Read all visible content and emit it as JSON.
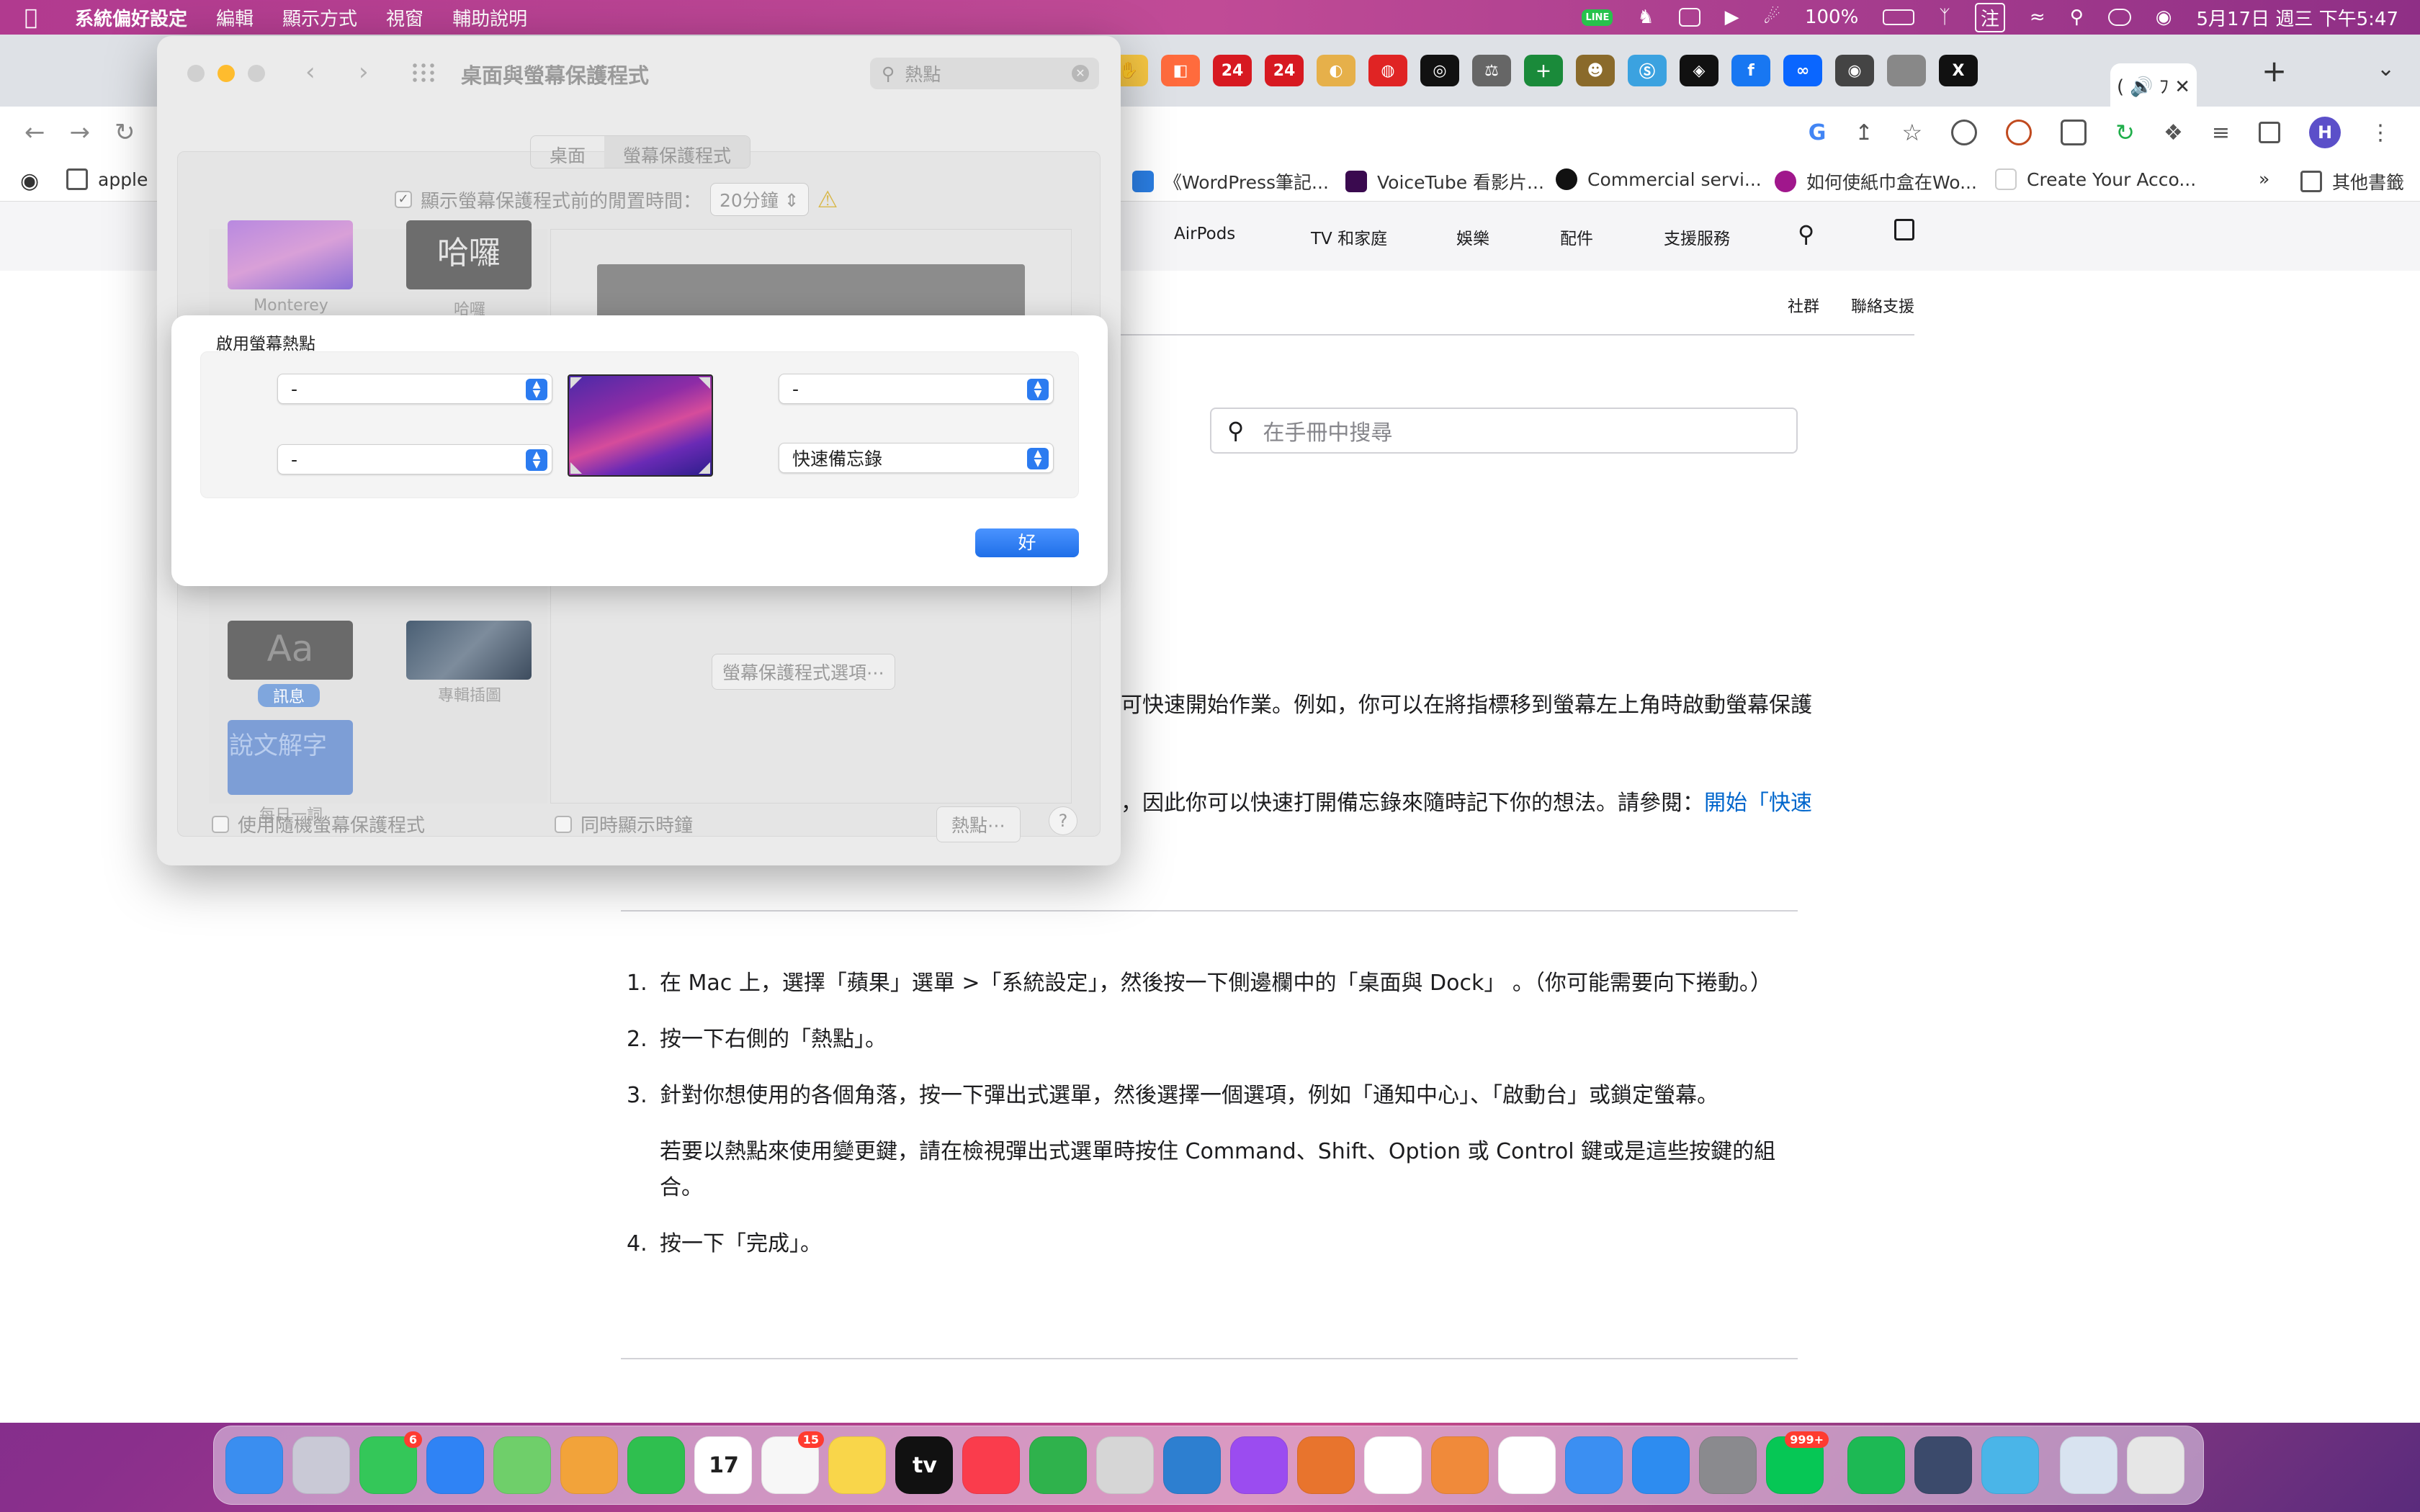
{
  "menubar": {
    "app_name": "系統偏好設定",
    "items": [
      "編輯",
      "顯示方式",
      "視窗",
      "輔助說明"
    ],
    "line_label": "LINE",
    "battery": "100%",
    "input_method": "注",
    "datetime": "5月17日 週三 下午5:47"
  },
  "browser": {
    "tab_favs": [
      {
        "label": "✋",
        "color": "#f5c542"
      },
      {
        "label": "◧",
        "color": "#ff6b3d"
      },
      {
        "label": "24",
        "color": "#d71921"
      },
      {
        "label": "24",
        "color": "#d71921"
      },
      {
        "label": "◐",
        "color": "#e6b04a"
      },
      {
        "label": "◍",
        "color": "#e02424"
      },
      {
        "label": "◎",
        "color": "#111111"
      },
      {
        "label": "⚖",
        "color": "#666666"
      },
      {
        "label": "＋",
        "color": "#1a8a3a"
      },
      {
        "label": "☻",
        "color": "#8a6a2b"
      },
      {
        "label": "Ⓢ",
        "color": "#3ba2e0"
      },
      {
        "label": "◈",
        "color": "#111111"
      },
      {
        "label": "f",
        "color": "#1877f2"
      },
      {
        "label": "∞",
        "color": "#0a66ff"
      },
      {
        "label": "◉",
        "color": "#444444"
      },
      {
        "label": "",
        "color": "#888888"
      },
      {
        "label": "X",
        "color": "#111111"
      }
    ],
    "active_tab_label": "( 🔊 ﾌ ✕",
    "bookmarks": [
      {
        "label": "apple"
      },
      {
        "label": "《WordPress筆記..."
      },
      {
        "label": "VoiceTube 看影片..."
      },
      {
        "label": "Commercial servi..."
      },
      {
        "label": "如何使紙巾盒在Wo..."
      },
      {
        "label": "Create Your Acco..."
      },
      {
        "label": "其他書籤"
      }
    ],
    "bookmark_more": "»",
    "profile_initial": "H"
  },
  "apple_page": {
    "nav": [
      "AirPods",
      "TV 和家庭",
      "娛樂",
      "配件",
      "支援服務"
    ],
    "subnav": [
      "社群",
      "聯絡支援"
    ],
    "search_placeholder": "在手冊中搜尋",
    "para1": "可快速開始作業。例如，你可以在將指標移到螢幕左上角時啟動螢幕保護",
    "para2_text": "，因此你可以快速打開備忘錄來隨時記下你的想法。請參閱：",
    "para2_link": "開始「快速",
    "steps": [
      {
        "n": "1.",
        "text": "在 Mac 上，選擇「蘋果」選單  >「系統設定」，然後按一下側邊欄中的「桌面與 Dock」 。（你可能需要向下捲動。）"
      },
      {
        "n": "2.",
        "text": "按一下右側的「熱點」。"
      },
      {
        "n": "3.",
        "text": "針對你想使用的各個角落，按一下彈出式選單，然後選擇一個選項，例如「通知中心」、「啟動台」或鎖定螢幕。"
      }
    ],
    "step3_note_line1": "若要以熱點來使用變更鍵，請在檢視彈出式選單時按住 Command、Shift、Option 或 Control 鍵或是這些按鍵的組",
    "step3_note_line2": "合。",
    "step4": {
      "n": "4.",
      "text": "按一下「完成」。"
    }
  },
  "prefs": {
    "title": "桌面與螢幕保護程式",
    "search_value": "熱點",
    "tabs": [
      "桌面",
      "螢幕保護程式"
    ],
    "start_after_label": "顯示螢幕保護程式前的閒置時間：",
    "start_after_value": "20分鐘",
    "savers": [
      {
        "label": "Monterey"
      },
      {
        "label": "哈囉",
        "thumb_text": "哈囉"
      },
      {
        "label": "訊息",
        "thumb_text": "Aa"
      },
      {
        "label": "專輯插圖"
      },
      {
        "label": "每日一詞",
        "thumb_text": "說文解字"
      }
    ],
    "saver_options_button": "螢幕保護程式選項⋯",
    "random_label": "使用隨機螢幕保護程式",
    "clock_label": "同時顯示時鐘",
    "hot_corners_button": "熱點⋯",
    "help_label": "?"
  },
  "hot_corners_sheet": {
    "title": "啟用螢幕熱點",
    "top_left": "-",
    "top_right": "-",
    "bottom_left": "-",
    "bottom_right": "快速備忘錄",
    "ok_label": "好"
  },
  "dock": {
    "apps": [
      {
        "name": "Finder",
        "color": "#3a8ef0"
      },
      {
        "name": "Launchpad",
        "color": "#c9c9d6"
      },
      {
        "name": "Messages",
        "color": "#34c759",
        "badge": "6"
      },
      {
        "name": "Mail",
        "color": "#2f83f5"
      },
      {
        "name": "Maps",
        "color": "#6fcf6a"
      },
      {
        "name": "Photos",
        "color": "#f2a33a"
      },
      {
        "name": "FaceTime",
        "color": "#2fbf4f"
      },
      {
        "name": "Calendar",
        "color": "#ffffff",
        "text": "17"
      },
      {
        "name": "Reminders",
        "color": "#f7f7f7",
        "badge": "15"
      },
      {
        "name": "Notes",
        "color": "#f9d64a"
      },
      {
        "name": "TV",
        "color": "#111111",
        "text": "tv"
      },
      {
        "name": "Music",
        "color": "#fa3c4c"
      },
      {
        "name": "Numbers",
        "color": "#2fb24c"
      },
      {
        "name": "Tool",
        "color": "#d6d6d6"
      },
      {
        "name": "Fan",
        "color": "#2d7fd0"
      },
      {
        "name": "Podcasts",
        "color": "#9b4cf0"
      },
      {
        "name": "Reeder",
        "color": "#e8742d"
      },
      {
        "name": "Cow",
        "color": "#ffffff"
      },
      {
        "name": "Shell",
        "color": "#f08a3a"
      },
      {
        "name": "Chrome",
        "color": "#ffffff"
      },
      {
        "name": "Safari",
        "color": "#3b8ff2"
      },
      {
        "name": "App Store",
        "color": "#2d8cf0"
      },
      {
        "name": "System Preferences",
        "color": "#8a8a8e"
      },
      {
        "name": "LINE",
        "color": "#06c755",
        "badge": "999+"
      },
      {
        "name": "Spotify",
        "color": "#1db954"
      },
      {
        "name": "Stacks",
        "color": "#3b4a6b"
      },
      {
        "name": "Klack",
        "color": "#4ab5e8"
      },
      {
        "name": "Documents",
        "color": "#d8e3f0"
      },
      {
        "name": "Trash",
        "color": "#e6e6e6"
      }
    ]
  }
}
